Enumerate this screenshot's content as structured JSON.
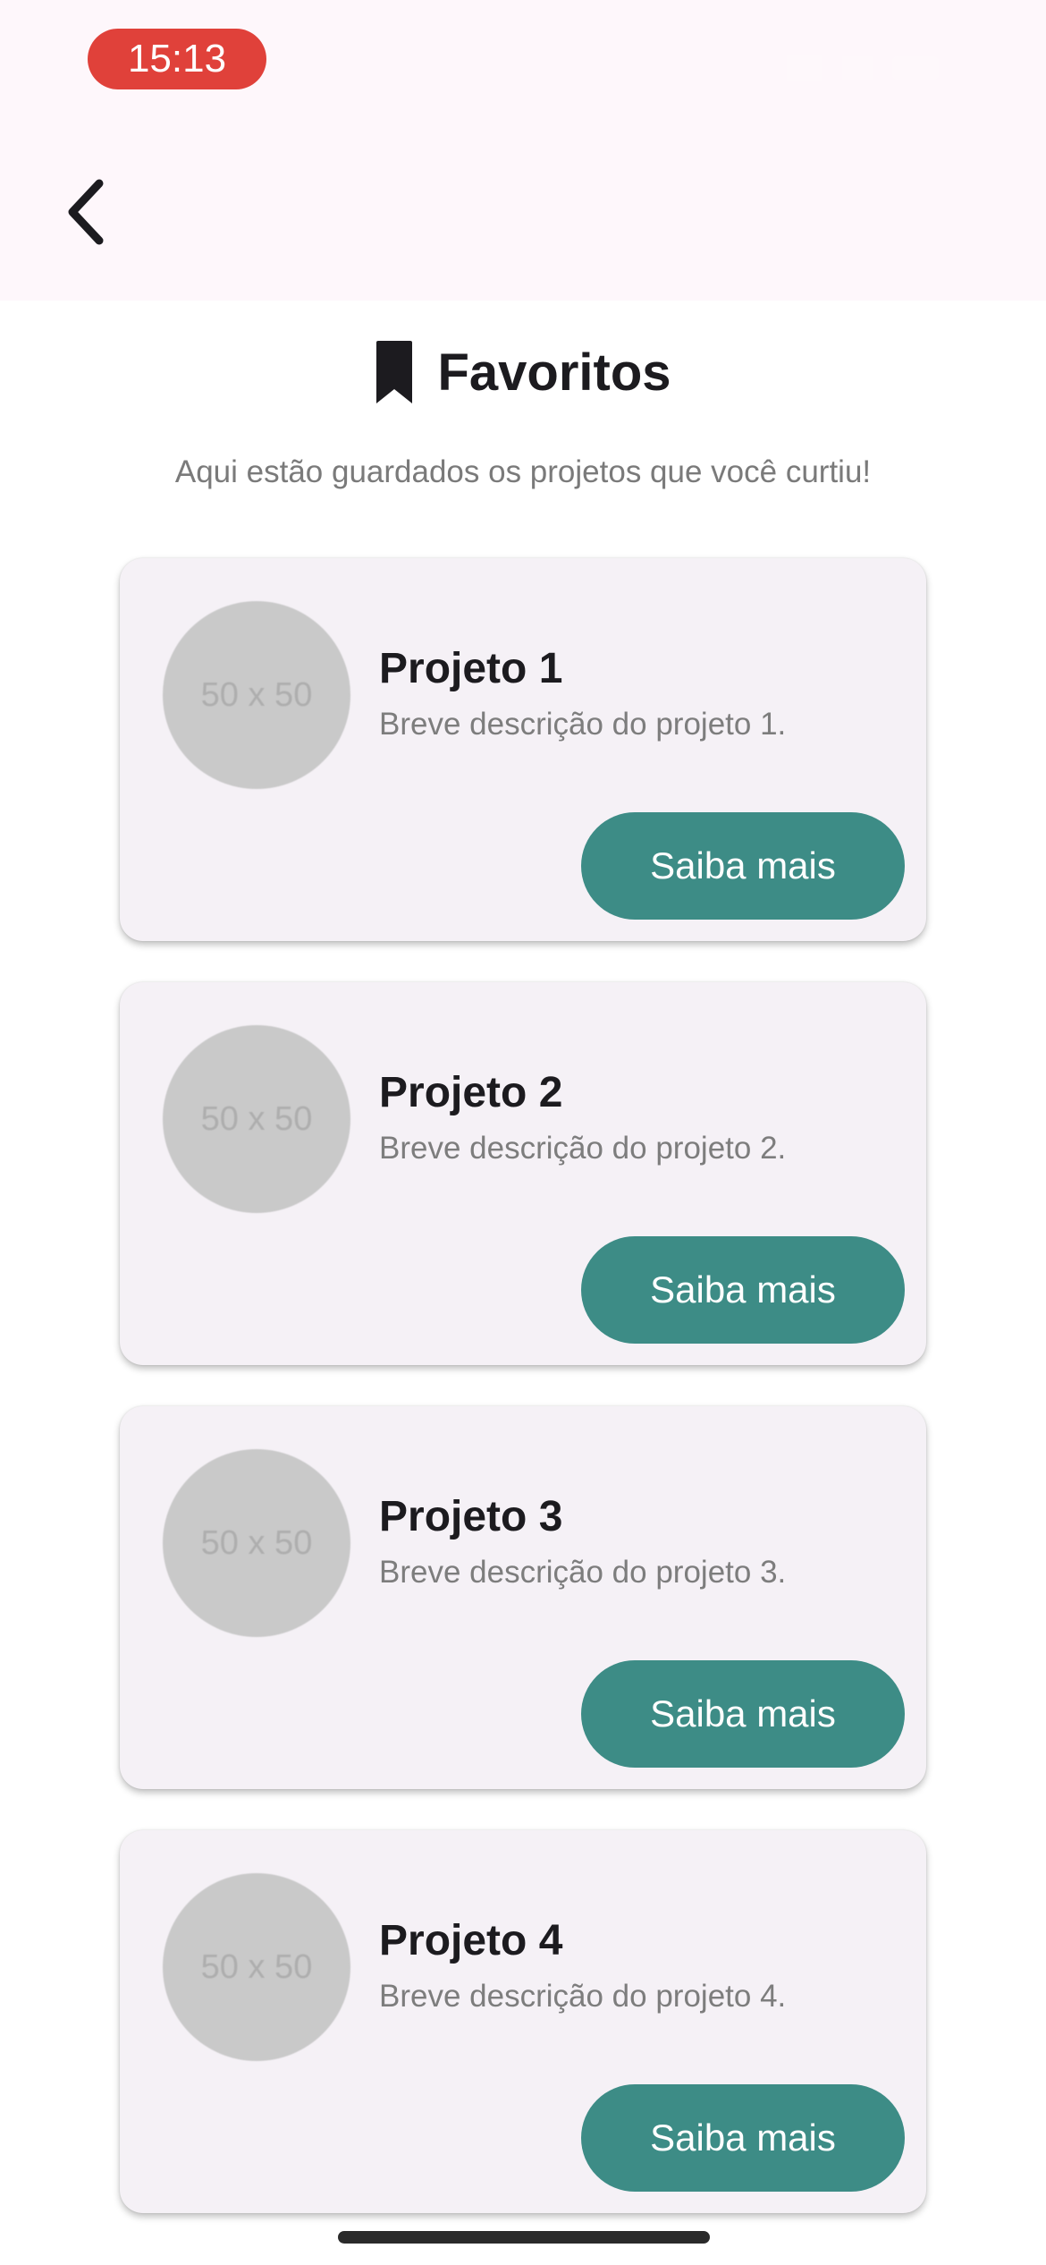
{
  "status_bar": {
    "time": "15:13",
    "icons": [
      "cellular-signal-icon",
      "wifi-icon",
      "battery-icon"
    ]
  },
  "nav": {
    "back_icon": "chevron-left-icon"
  },
  "header": {
    "icon": "bookmark-icon",
    "title": "Favoritos",
    "subtitle": "Aqui estão guardados os projetos que você curtiu!"
  },
  "projects": [
    {
      "image_placeholder": "50 x 50",
      "title": "Projeto 1",
      "description": "Breve descrição do projeto 1.",
      "button_label": "Saiba mais"
    },
    {
      "image_placeholder": "50 x 50",
      "title": "Projeto 2",
      "description": "Breve descrição do projeto 2.",
      "button_label": "Saiba mais"
    },
    {
      "image_placeholder": "50 x 50",
      "title": "Projeto 3",
      "description": "Breve descrição do projeto 3.",
      "button_label": "Saiba mais"
    },
    {
      "image_placeholder": "50 x 50",
      "title": "Projeto 4",
      "description": "Breve descrição do projeto 4.",
      "button_label": "Saiba mais"
    }
  ],
  "colors": {
    "accent": "#3d8c86",
    "status_time_bg": "#e0413a",
    "top_bar_bg": "#fef7fb",
    "card_bg": "#f5f1f6"
  }
}
